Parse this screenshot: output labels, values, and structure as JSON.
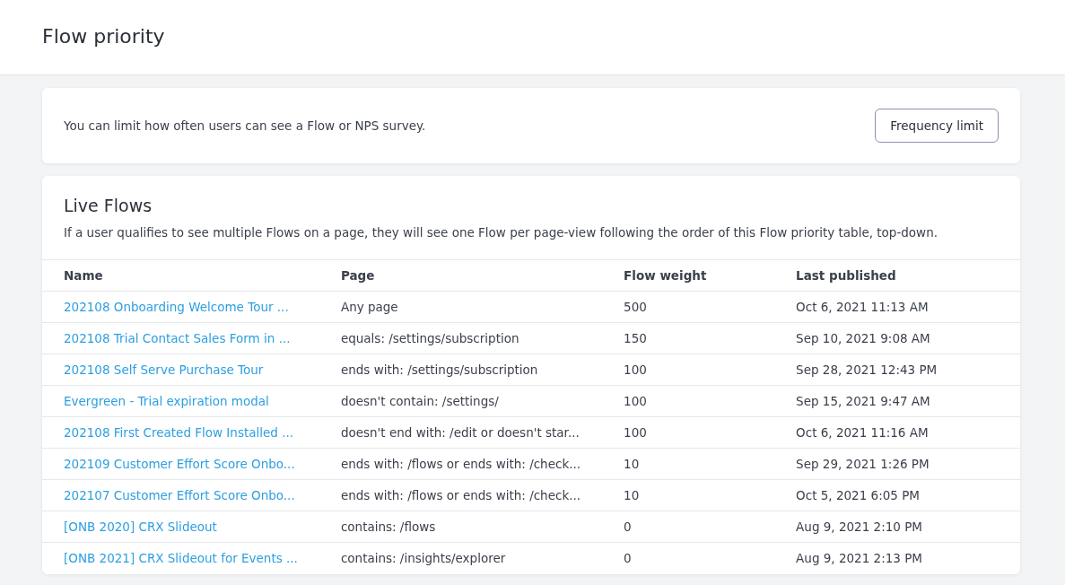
{
  "page": {
    "title": "Flow priority"
  },
  "notice": {
    "text": "You can limit how often users can see a Flow or NPS survey.",
    "button": "Frequency limit"
  },
  "live_flows": {
    "title": "Live Flows",
    "description": "If a user qualifies to see multiple Flows on a page, they will see one Flow per page-view following the order of this Flow priority table, top-down.",
    "table": {
      "columns": [
        "Name",
        "Page",
        "Flow weight",
        "Last published"
      ],
      "rows": [
        {
          "name": "202108 Onboarding Welcome Tour ...",
          "page": "Any page",
          "weight": "500",
          "published": "Oct 6, 2021 11:13 AM"
        },
        {
          "name": "202108 Trial Contact Sales Form in ...",
          "page": "equals: /settings/subscription",
          "weight": "150",
          "published": "Sep 10, 2021 9:08 AM"
        },
        {
          "name": "202108 Self Serve Purchase Tour",
          "page": "ends with: /settings/subscription",
          "weight": "100",
          "published": "Sep 28, 2021 12:43 PM"
        },
        {
          "name": "Evergreen - Trial expiration modal",
          "page": "doesn't contain: /settings/",
          "weight": "100",
          "published": "Sep 15, 2021 9:47 AM"
        },
        {
          "name": "202108 First Created Flow Installed ...",
          "page": "doesn't end with: /edit or doesn't star...",
          "weight": "100",
          "published": "Oct 6, 2021 11:16 AM"
        },
        {
          "name": "202109 Customer Effort Score Onbo...",
          "page": "ends with: /flows or ends with: /check...",
          "weight": "10",
          "published": "Sep 29, 2021 1:26 PM"
        },
        {
          "name": "202107 Customer Effort Score Onbo...",
          "page": "ends with: /flows or ends with: /check...",
          "weight": "10",
          "published": "Oct 5, 2021 6:05 PM"
        },
        {
          "name": "[ONB 2020] CRX Slideout",
          "page": "contains: /flows",
          "weight": "0",
          "published": "Aug 9, 2021 2:10 PM"
        },
        {
          "name": "[ONB 2021] CRX Slideout for Events ...",
          "page": "contains: /insights/explorer",
          "weight": "0",
          "published": "Aug 9, 2021 2:13 PM"
        }
      ]
    }
  }
}
